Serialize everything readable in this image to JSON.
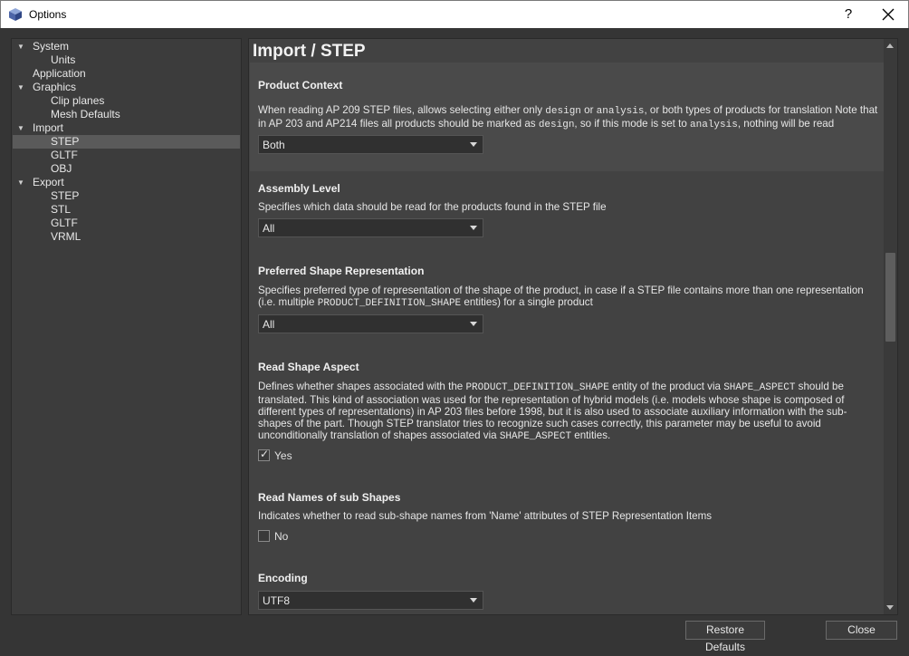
{
  "window": {
    "title": "Options",
    "help_glyph": "?",
    "close_glyph": "✕",
    "icon": "cube-icon"
  },
  "tree": [
    {
      "label": "System",
      "level": 0,
      "expanded": true
    },
    {
      "label": "Units",
      "level": 1
    },
    {
      "label": "Application",
      "level": 0
    },
    {
      "label": "Graphics",
      "level": 0,
      "expanded": true
    },
    {
      "label": "Clip planes",
      "level": 1
    },
    {
      "label": "Mesh Defaults",
      "level": 1
    },
    {
      "label": "Import",
      "level": 0,
      "expanded": true
    },
    {
      "label": "STEP",
      "level": 1,
      "selected": true
    },
    {
      "label": "GLTF",
      "level": 1
    },
    {
      "label": "OBJ",
      "level": 1
    },
    {
      "label": "Export",
      "level": 0,
      "expanded": true
    },
    {
      "label": "STEP",
      "level": 1
    },
    {
      "label": "STL",
      "level": 1
    },
    {
      "label": "GLTF",
      "level": 1
    },
    {
      "label": "VRML",
      "level": 1
    }
  ],
  "page": {
    "title": "Import / STEP"
  },
  "sections": {
    "product_context": {
      "title": "Product Context",
      "desc": [
        {
          "t": "When reading AP 209 STEP files, allows selecting either only "
        },
        {
          "c": "design"
        },
        {
          "t": " or "
        },
        {
          "c": "analysis"
        },
        {
          "t": ", or both types of products for translation Note that in AP 203 and AP214 files all products should be marked as "
        },
        {
          "c": "design"
        },
        {
          "t": ", so if this mode is set to "
        },
        {
          "c": "analysis"
        },
        {
          "t": ", nothing will be read"
        }
      ],
      "value": "Both"
    },
    "assembly_level": {
      "title": "Assembly Level",
      "desc": [
        {
          "t": "Specifies which data should be read for the products found in the STEP file"
        }
      ],
      "value": "All"
    },
    "preferred_shape": {
      "title": "Preferred Shape Representation",
      "desc": [
        {
          "t": "Specifies preferred type of representation of the shape of the product, in case if a STEP file contains more than one representation (i.e. multiple "
        },
        {
          "c": "PRODUCT_DEFINITION_SHAPE"
        },
        {
          "t": " entities) for a single product"
        }
      ],
      "value": "All"
    },
    "read_shape_aspect": {
      "title": "Read Shape Aspect",
      "desc": [
        {
          "t": "Defines whether shapes associated with the "
        },
        {
          "c": "PRODUCT_DEFINITION_SHAPE"
        },
        {
          "t": " entity of the product via "
        },
        {
          "c": "SHAPE_ASPECT"
        },
        {
          "t": " should be translated. This kind of association was used for the representation of hybrid models (i.e. models whose shape is composed of different types of representations) in AP 203 files before 1998, but it is also used to associate auxiliary information with the sub-shapes of the part. Though STEP translator tries to recognize such cases correctly, this parameter may be useful to avoid unconditionally translation of shapes associated via "
        },
        {
          "c": "SHAPE_ASPECT"
        },
        {
          "t": " entities."
        }
      ],
      "check_label": "Yes",
      "checked": true
    },
    "read_names": {
      "title": "Read Names of sub Shapes",
      "desc": [
        {
          "t": "Indicates whether to read sub-shape names from 'Name' attributes of STEP Representation Items"
        }
      ],
      "check_label": "No",
      "checked": false
    },
    "encoding": {
      "title": "Encoding",
      "value": "UTF8"
    }
  },
  "buttons": {
    "restore_defaults": "Restore Defaults",
    "close": "Close"
  }
}
